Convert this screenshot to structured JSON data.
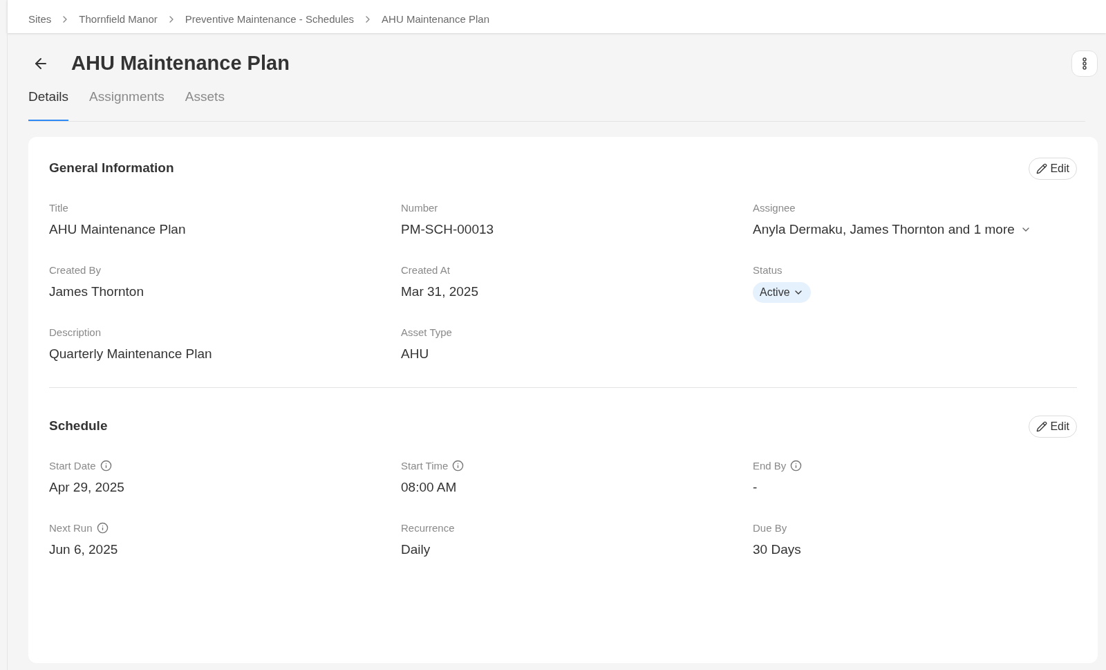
{
  "breadcrumb": [
    "Sites",
    "Thornfield Manor",
    "Preventive Maintenance - Schedules",
    "AHU Maintenance Plan"
  ],
  "title": "AHU Maintenance Plan",
  "tabs": [
    {
      "label": "Details",
      "selected": true
    },
    {
      "label": "Assignments",
      "selected": false
    },
    {
      "label": "Assets",
      "selected": false
    }
  ],
  "sections": [
    {
      "title": "General Information",
      "edit_label": "Edit",
      "fields": [
        {
          "label": "Title",
          "value": "AHU Maintenance Plan",
          "kind": "text",
          "info": false
        },
        {
          "label": "Number",
          "value": "PM-SCH-00013",
          "kind": "text",
          "info": false
        },
        {
          "label": "Assignee",
          "value": "Anyla Dermaku, James Thornton and 1 more",
          "kind": "dropdown",
          "info": false
        },
        {
          "label": "Created By",
          "value": "James Thornton",
          "kind": "text",
          "info": false
        },
        {
          "label": "Created At",
          "value": "Mar 31, 2025",
          "kind": "text",
          "info": false
        },
        {
          "label": "Status",
          "value": "Active",
          "kind": "status",
          "info": false
        },
        {
          "label": "Description",
          "value": "Quarterly Maintenance Plan",
          "kind": "text",
          "info": false
        },
        {
          "label": "Asset Type",
          "value": "AHU",
          "kind": "text",
          "info": false
        }
      ]
    },
    {
      "title": "Schedule",
      "edit_label": "Edit",
      "fields": [
        {
          "label": "Start Date",
          "value": "Apr 29, 2025",
          "kind": "text",
          "info": true
        },
        {
          "label": "Start Time",
          "value": "08:00 AM",
          "kind": "text",
          "info": true
        },
        {
          "label": "End By",
          "value": "-",
          "kind": "text",
          "info": true
        },
        {
          "label": "Next Run",
          "value": "Jun 6, 2025",
          "kind": "text",
          "info": true
        },
        {
          "label": "Recurrence",
          "value": "Daily",
          "kind": "text",
          "info": false
        },
        {
          "label": "Due By",
          "value": "30 Days",
          "kind": "text",
          "info": false
        }
      ]
    }
  ]
}
